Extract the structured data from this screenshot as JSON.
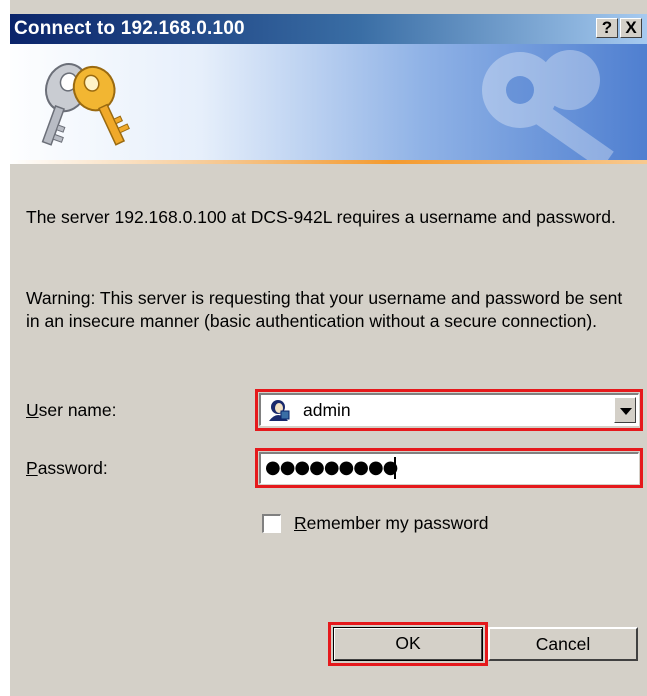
{
  "window": {
    "title": "Connect to 192.168.0.100",
    "help_button": "?",
    "close_button": "X"
  },
  "banner": {
    "icon": "keys-icon",
    "watermark_icon": "keys-watermark-icon",
    "accent_colors": [
      "#0a246a",
      "#f39a2f",
      "#4f7fd0"
    ]
  },
  "message": {
    "line1": "The server 192.168.0.100 at DCS-942L requires a username and password.",
    "warning": "Warning: This server is requesting that your username and password be sent in an insecure manner (basic authentication without a secure connection)."
  },
  "form": {
    "username_label_prefix": "U",
    "username_label_rest": "ser name:",
    "username_value": "admin",
    "username_icon": "user-icon",
    "password_label_prefix": "P",
    "password_label_rest": "assword:",
    "password_masked": "●●●●●●●●●",
    "remember_prefix": "R",
    "remember_rest": "emember my password",
    "remember_checked": false
  },
  "buttons": {
    "ok": "OK",
    "cancel": "Cancel"
  },
  "highlight_color": "#e5191c"
}
